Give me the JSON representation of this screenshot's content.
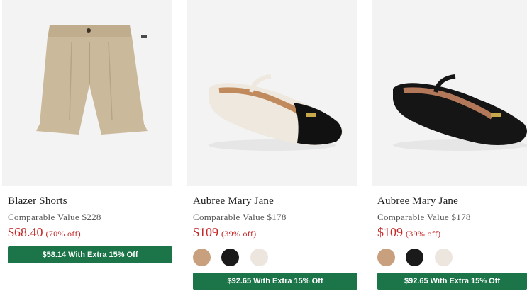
{
  "products": [
    {
      "name": "Blazer Shorts",
      "image": "beige-shorts",
      "comparable": "Comparable Value $228",
      "price": "$68.40",
      "discount": "(70% off)",
      "promo": "$58.14 With Extra 15% Off",
      "swatches": []
    },
    {
      "name": "Aubree Mary Jane",
      "image": "cream-mary-jane-shoe",
      "comparable": "Comparable Value $178",
      "price": "$109",
      "discount": "(39% off)",
      "promo": "$92.65 With Extra 15% Off",
      "swatches": [
        "#c9a07d",
        "#1a1a1a",
        "#ece6de"
      ]
    },
    {
      "name": "Aubree Mary Jane",
      "image": "black-mary-jane-shoe",
      "comparable": "Comparable Value $178",
      "price": "$109",
      "discount": "(39% off)",
      "promo": "$92.65 With Extra 15% Off",
      "swatches": [
        "#c9a07d",
        "#1a1a1a",
        "#ece6de"
      ]
    }
  ],
  "colors": {
    "sale": "#c62828",
    "promo_bg": "#1b7548",
    "image_bg": "#f3f3f3"
  }
}
